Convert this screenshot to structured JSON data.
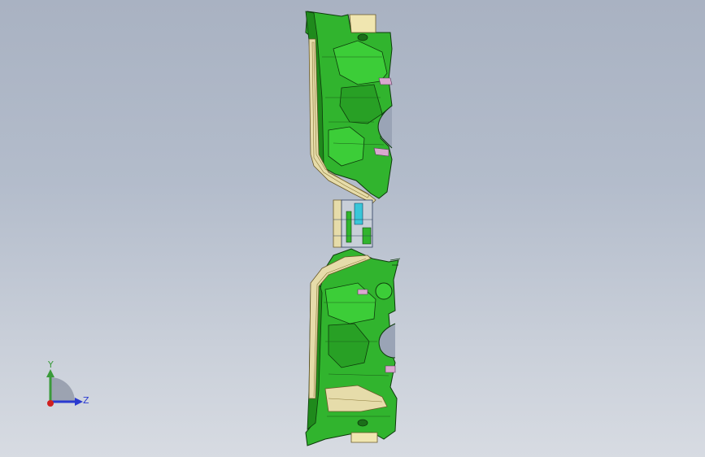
{
  "viewport": {
    "background_top": "#a9b2c2",
    "background_bottom": "#d7dbe2"
  },
  "model": {
    "part_color": "#2fb52c",
    "part_dark": "#1c7a1a",
    "edge_color": "#0d3a0b",
    "liner_color": "#e6dcaa",
    "accent_pink": "#d9a8cf",
    "accent_cyan": "#39c6d8"
  },
  "triad": {
    "y_label": "Y",
    "z_label": "Z",
    "y_color": "#3a9a3a",
    "z_color": "#2a3ad0",
    "x_color": "#d02020"
  }
}
